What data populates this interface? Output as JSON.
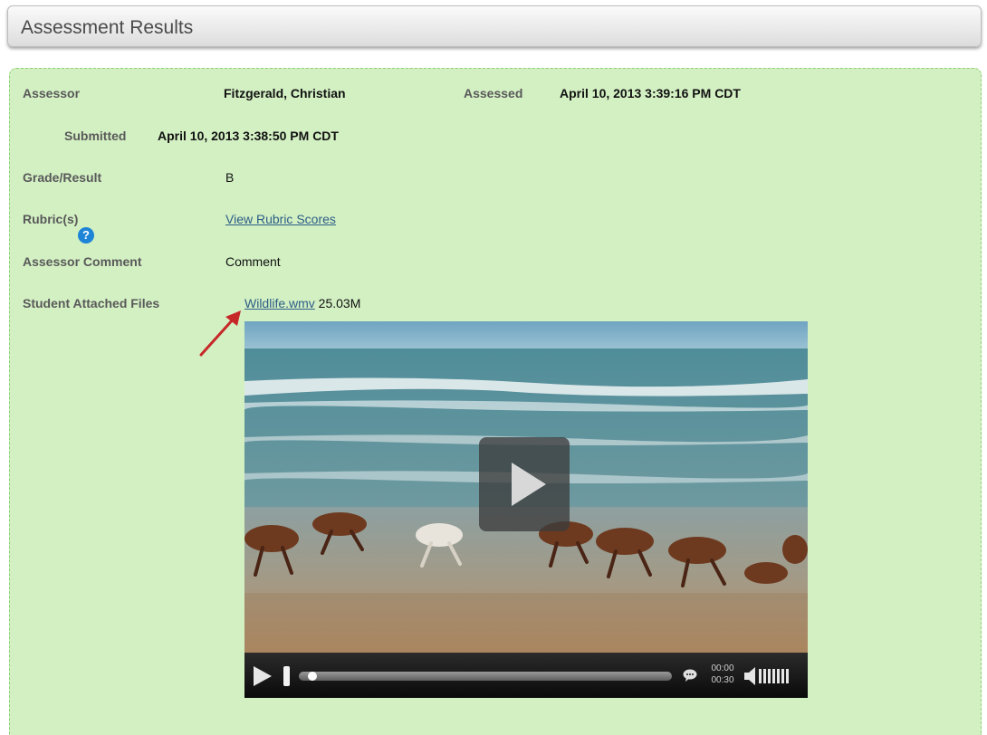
{
  "header": {
    "title": "Assessment Results"
  },
  "details": {
    "assessor_label": "Assessor",
    "assessor_value": "Fitzgerald, Christian",
    "assessed_label": "Assessed",
    "assessed_value": "April 10, 2013 3:39:16 PM CDT",
    "submitted_label": "Submitted",
    "submitted_value": "April 10, 2013 3:38:50 PM CDT",
    "grade_label": "Grade/Result",
    "grade_value": "B",
    "rubric_label": "Rubric(s)",
    "rubric_link": "View Rubric Scores",
    "help_glyph": "?",
    "comment_label": "Assessor Comment",
    "comment_value": "Comment",
    "files_label": "Student Attached Files",
    "file_name": "Wildlife.wmv",
    "file_size": "25.03M"
  },
  "player": {
    "time_current": "00:00",
    "time_total": "00:30",
    "progress": 0.0
  },
  "colors": {
    "panel_bg": "#d3f0c3",
    "panel_border": "#8fcf72",
    "link": "#2c5d86",
    "help_icon": "#1d84d6",
    "arrow": "#c62828"
  },
  "icons": [
    "help-icon",
    "annotation-arrow-icon",
    "play-icon",
    "captions-icon",
    "volume-icon"
  ]
}
